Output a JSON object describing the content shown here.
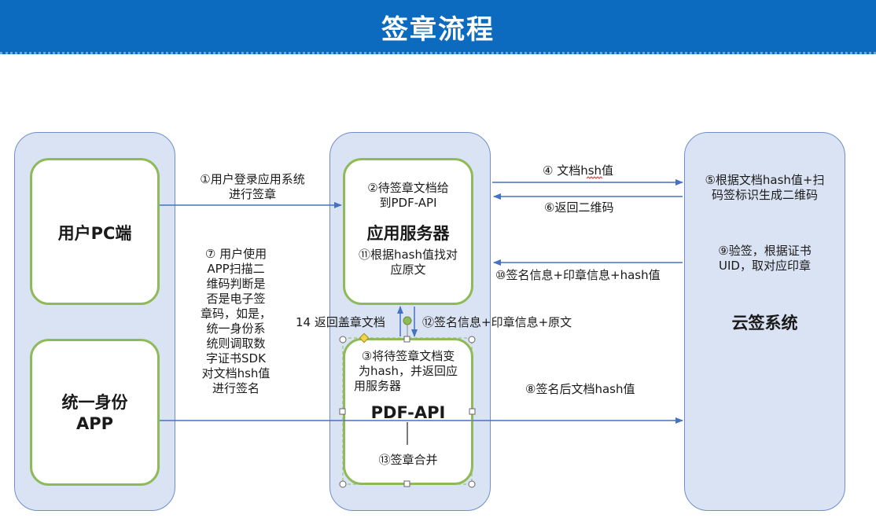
{
  "header": {
    "title": "签章流程"
  },
  "nodes": {
    "user_pc": "用户PC端",
    "app_server": "应用服务器",
    "pdf_api": "PDF-API",
    "identity_app_line1": "统一身份",
    "identity_app_line2": "APP",
    "cloud_sign": "云签系统"
  },
  "steps": {
    "s1_line1": "①用户登录应用系统",
    "s1_line2": "进行签章",
    "s2_line1": "②待签章文档给",
    "s2_line2": "到PDF-API",
    "s3_line1": "③将待签章文档变",
    "s3_line2": "为hash，并返回应",
    "s3_line3": "用服务器",
    "s4": "④ 文档hsh值",
    "s5_line1": "⑤根据文档hash值+扫",
    "s5_line2": "码签标识生成二维码",
    "s6": "⑥返回二维码",
    "s7_lines": [
      "⑦ 用户使用",
      "APP扫描二",
      "维码判断是",
      "否是电子签",
      "章码，如是，",
      "统一身份系",
      "统则调取数",
      "字证书SDK",
      "对文档hsh值",
      "进行签名"
    ],
    "s8": "⑧签名后文档hash值",
    "s9_line1": "⑨验签，根据证书",
    "s9_line2": "UID，取对应印章",
    "s10": "⑩签名信息+印章信息+hash值",
    "s11_line1": "⑪根据hash值找对",
    "s11_line2": "应原文",
    "s12": "⑫签名信息+印章信息+原文",
    "s13": "⑬签章合并",
    "s14": "14 返回盖章文档"
  },
  "colors": {
    "header": "#0c6bbf",
    "lane_fill": "#dae3f3",
    "lane_border": "#6e8fc7",
    "box_border": "#8fba5a",
    "arrow": "#4472c4"
  }
}
